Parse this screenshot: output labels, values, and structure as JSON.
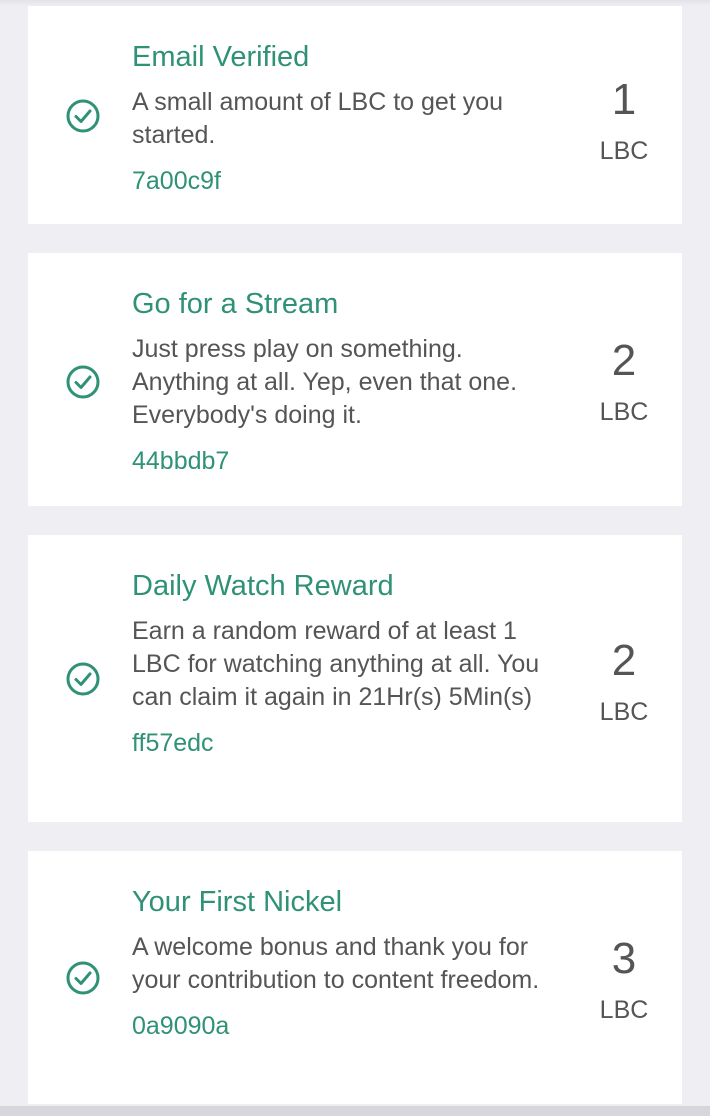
{
  "colors": {
    "accent": "#2f9176",
    "text_secondary": "#555555",
    "background": "#eeeef3",
    "card": "#ffffff"
  },
  "rewards": [
    {
      "icon": "check-circle-icon",
      "title": "Email Verified",
      "description": "A small amount of LBC to get you started.",
      "txid": "7a00c9f",
      "amount": "1",
      "unit": "LBC"
    },
    {
      "icon": "check-circle-icon",
      "title": "Go for a Stream",
      "description": "Just press play on something. Anything at all. Yep, even that one. Everybody's doing it.",
      "txid": "44bbdb7",
      "amount": "2",
      "unit": "LBC"
    },
    {
      "icon": "check-circle-icon",
      "title": "Daily Watch Reward",
      "description": "Earn a random reward of at least 1 LBC for watching anything at all. You can claim it again in 21Hr(s) 5Min(s)",
      "txid": "ff57edc",
      "amount": "2",
      "unit": "LBC"
    },
    {
      "icon": "check-circle-icon",
      "title": "Your First Nickel",
      "description": "A welcome bonus and thank you for your contribution to content freedom.",
      "txid": "0a9090a",
      "amount": "3",
      "unit": "LBC"
    }
  ]
}
